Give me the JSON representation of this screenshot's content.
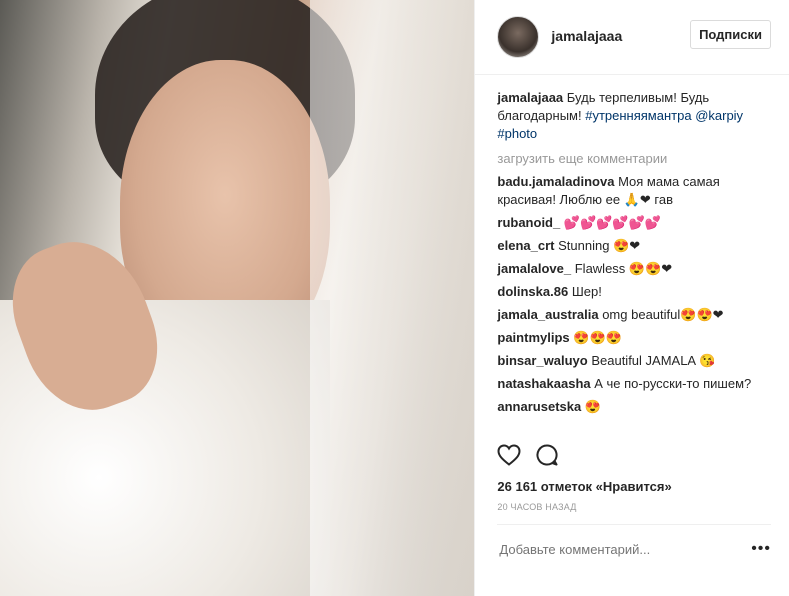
{
  "post": {
    "username": "jamalajaaa",
    "follow_label": "Подписки",
    "caption": {
      "username": "jamalajaaa",
      "text": "Будь терпеливым! Будь благодарным!",
      "tag1": "#утренняямантра",
      "mention": "@karpiy",
      "tag2": "#photo"
    },
    "load_more": "загрузить еще комментарии",
    "comments": [
      {
        "user": "badu.jamaladinova",
        "text": "Моя мама самая красивая! Люблю ее 🙏❤ гав"
      },
      {
        "user": "rubanoid_",
        "text": "💕💕💕💕💕💕"
      },
      {
        "user": "elena_crt",
        "text": "Stunning 😍❤"
      },
      {
        "user": "jamalalove_",
        "text": "Flawless 😍😍❤"
      },
      {
        "user": "dolinska.86",
        "text": "Шер!"
      },
      {
        "user": "jamala_australia",
        "text": "omg beautiful😍😍❤"
      },
      {
        "user": "paintmylips",
        "text": "😍😍😍"
      },
      {
        "user": "binsar_waluyo",
        "text": "Beautiful JAMALA 😘"
      },
      {
        "user": "natashakaasha",
        "text": "А че по-русски-то пишем?"
      },
      {
        "user": "annarusetska",
        "text": "😍"
      }
    ],
    "likes": "26 161 отметок «Нравится»",
    "time": "20 ЧАСОВ НАЗАД",
    "add_comment_placeholder": "Добавьте комментарий...",
    "more_options": "•••",
    "icons": {
      "like": "heart-icon",
      "comment": "comment-icon"
    }
  }
}
